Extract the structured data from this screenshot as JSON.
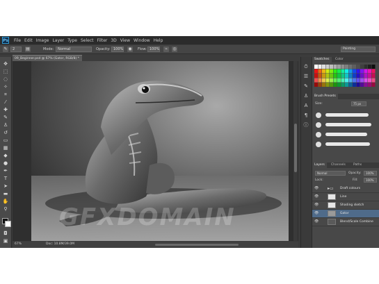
{
  "app": {
    "logo": "Ps",
    "menu": [
      "File",
      "Edit",
      "Image",
      "Layer",
      "Type",
      "Select",
      "Filter",
      "3D",
      "View",
      "Window",
      "Help"
    ],
    "workspace": "Painting"
  },
  "options_bar": {
    "mode_label": "Mode:",
    "mode_value": "Normal",
    "opacity_label": "Opacity:",
    "opacity_value": "100%",
    "flow_label": "Flow:",
    "flow_value": "100%",
    "brush_size": "2"
  },
  "document": {
    "tab_title": "09_Beginner.psd @ 67% (Gator, RGB/8) *",
    "zoom": "67%",
    "doc_size": "Doc: 10.8M/39.0M",
    "watermark": "GFXDOMAIN"
  },
  "panels": {
    "color_tabs": [
      "Swatches",
      "Color"
    ],
    "brush_tabs": [
      "Brush Presets"
    ],
    "brush_size_label": "Size:",
    "brush_size_value": "75 px",
    "layers_tabs": [
      "Layers",
      "Channels",
      "Paths"
    ],
    "blend_mode": "Normal",
    "opacity_label": "Opacity:",
    "opacity_value": "100%",
    "lock_label": "Lock:",
    "fill_label": "Fill:",
    "fill_value": "100%",
    "layers": [
      {
        "name": "Draft colours",
        "selected": false,
        "type": "group"
      },
      {
        "name": "Line",
        "selected": false,
        "type": "layer"
      },
      {
        "name": "Shading sketch",
        "selected": false,
        "type": "layer"
      },
      {
        "name": "Gator",
        "selected": true,
        "type": "layer"
      },
      {
        "name": "Blend/Scale Combine",
        "selected": false,
        "type": "layer"
      }
    ]
  },
  "colors": {
    "accent": "#2f9bd6",
    "selection": "#4f6b8a",
    "ui_dark": "#3c3c3c"
  }
}
